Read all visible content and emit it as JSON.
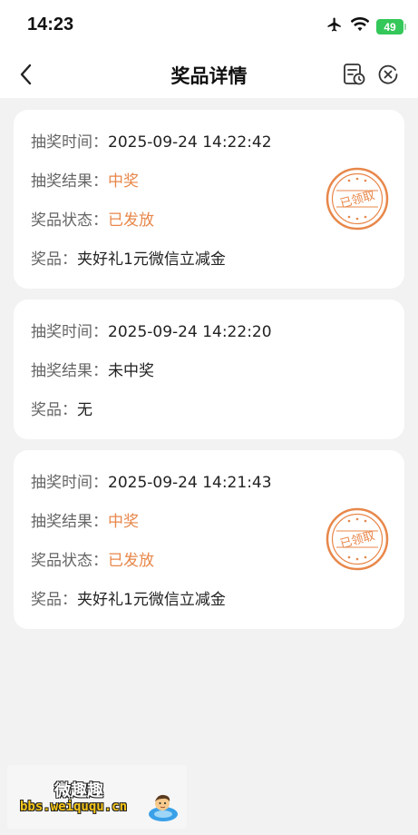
{
  "status_bar": {
    "time": "14:23",
    "battery": "49"
  },
  "nav": {
    "title": "奖品详情",
    "icons": [
      "back-arrow-icon",
      "record-clock-icon",
      "close-circle-icon"
    ]
  },
  "records": [
    {
      "time_label": "抽奖时间：",
      "time_value": "2025-09-24 14:22:42",
      "result_label": "抽奖结果：",
      "result_value": "中奖",
      "status_label": "奖品状态：",
      "status_value": "已发放",
      "prize_label": "奖品：",
      "prize_value": "夹好礼1元微信立减金",
      "stamp": "已领取"
    },
    {
      "time_label": "抽奖时间：",
      "time_value": "2025-09-24 14:22:20",
      "result_label": "抽奖结果：",
      "result_value": "未中奖",
      "prize_label": "奖品：",
      "prize_value": "无"
    },
    {
      "time_label": "抽奖时间：",
      "time_value": "2025-09-24 14:21:43",
      "result_label": "抽奖结果：",
      "result_value": "中奖",
      "status_label": "奖品状态：",
      "status_value": "已发放",
      "prize_label": "奖品：",
      "prize_value": "夹好礼1元微信立减金",
      "stamp": "已领取"
    }
  ],
  "watermark": {
    "name": "微趣趣",
    "url": "bbs.weiququ.cn"
  },
  "colors": {
    "accent_orange": "#e8874a",
    "background": "#f2f2f2",
    "battery_green": "#34c759"
  }
}
